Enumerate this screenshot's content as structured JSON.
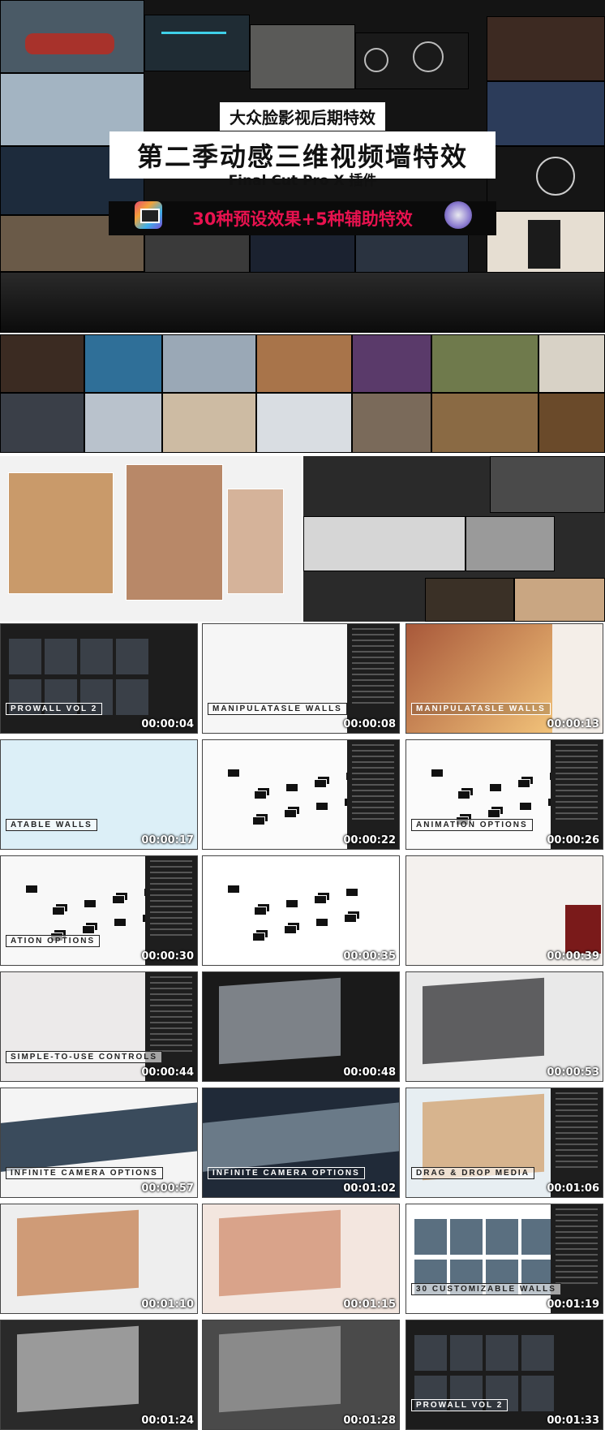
{
  "hero": {
    "top_label": "大众脸影视后期特效",
    "main_title": "第二季动感三维视频墙特效",
    "subtitle": "Final Cut Pro X 插件",
    "feature_bar": "30种预设效果+5种辅助特效",
    "icons": [
      "final-cut-pro-icon",
      "motion-icon"
    ]
  },
  "thumbnails": [
    {
      "caption": "PROWALL VOL 2",
      "timestamp": "00:00:04"
    },
    {
      "caption": "MANIPULATASLE WALLS",
      "timestamp": "00:00:08"
    },
    {
      "caption": "MANIPULATASLE WALLS",
      "timestamp": "00:00:13"
    },
    {
      "caption": "ATABLE WALLS",
      "timestamp": "00:00:17"
    },
    {
      "caption": "",
      "timestamp": "00:00:22"
    },
    {
      "caption": "ANIMATION OPTIONS",
      "timestamp": "00:00:26"
    },
    {
      "caption": "ATION OPTIONS",
      "timestamp": "00:00:30"
    },
    {
      "caption": "",
      "timestamp": "00:00:35"
    },
    {
      "caption": "",
      "timestamp": "00:00:39"
    },
    {
      "caption": "SIMPLE-TO-USE CONTROLS",
      "timestamp": "00:00:44"
    },
    {
      "caption": "",
      "timestamp": "00:00:48"
    },
    {
      "caption": "",
      "timestamp": "00:00:53"
    },
    {
      "caption": "INFINITE CAMERA OPTIONS",
      "timestamp": "00:00:57"
    },
    {
      "caption": "INFINITE CAMERA OPTIONS",
      "timestamp": "00:01:02"
    },
    {
      "caption": "DRAG & DROP MEDIA",
      "timestamp": "00:01:06"
    },
    {
      "caption": "",
      "timestamp": "00:01:10"
    },
    {
      "caption": "",
      "timestamp": "00:01:15"
    },
    {
      "caption": "30 CUSTOMIZABLE WALLS",
      "timestamp": "00:01:19"
    },
    {
      "caption": "",
      "timestamp": "00:01:24"
    },
    {
      "caption": "",
      "timestamp": "00:01:28"
    },
    {
      "caption": "PROWALL VOL 2",
      "timestamp": "00:01:33"
    }
  ]
}
